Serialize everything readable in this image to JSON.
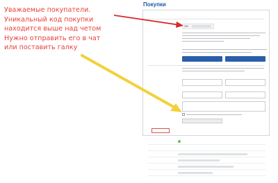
{
  "page": {
    "title": "Покупки",
    "top_links": [
      "",
      "",
      "",
      ""
    ]
  },
  "panel": {
    "section_heading": "",
    "code_label": "",
    "code_value": "111",
    "contact_label": "",
    "contact_note": "",
    "btn_primary_left": "",
    "btn_primary_right": "",
    "name_label": "",
    "email_label": "",
    "phone_label": "",
    "comment_label": "",
    "checkbox_label": "",
    "submit_label": ""
  },
  "cancel_label": "",
  "details": {
    "rows": [
      {
        "label": "",
        "value": ""
      },
      {
        "label": "",
        "value": ""
      },
      {
        "label": "",
        "value": ""
      },
      {
        "label": "",
        "value": ""
      },
      {
        "label": "",
        "value": ""
      },
      {
        "label": "",
        "value": ""
      }
    ]
  },
  "note": {
    "lines": [
      "Уважаемые покупатели.",
      "Уникальный код покупки",
      "находится выше над четом",
      "Нужно отправить его в чат",
      "или поставить галку"
    ]
  },
  "colors": {
    "note_text": "#e8413a",
    "red_arrow": "#d62a2a",
    "yellow_arrow": "#f2d13a",
    "primary_button": "#2b5ea9",
    "link": "#1e5aa8"
  }
}
